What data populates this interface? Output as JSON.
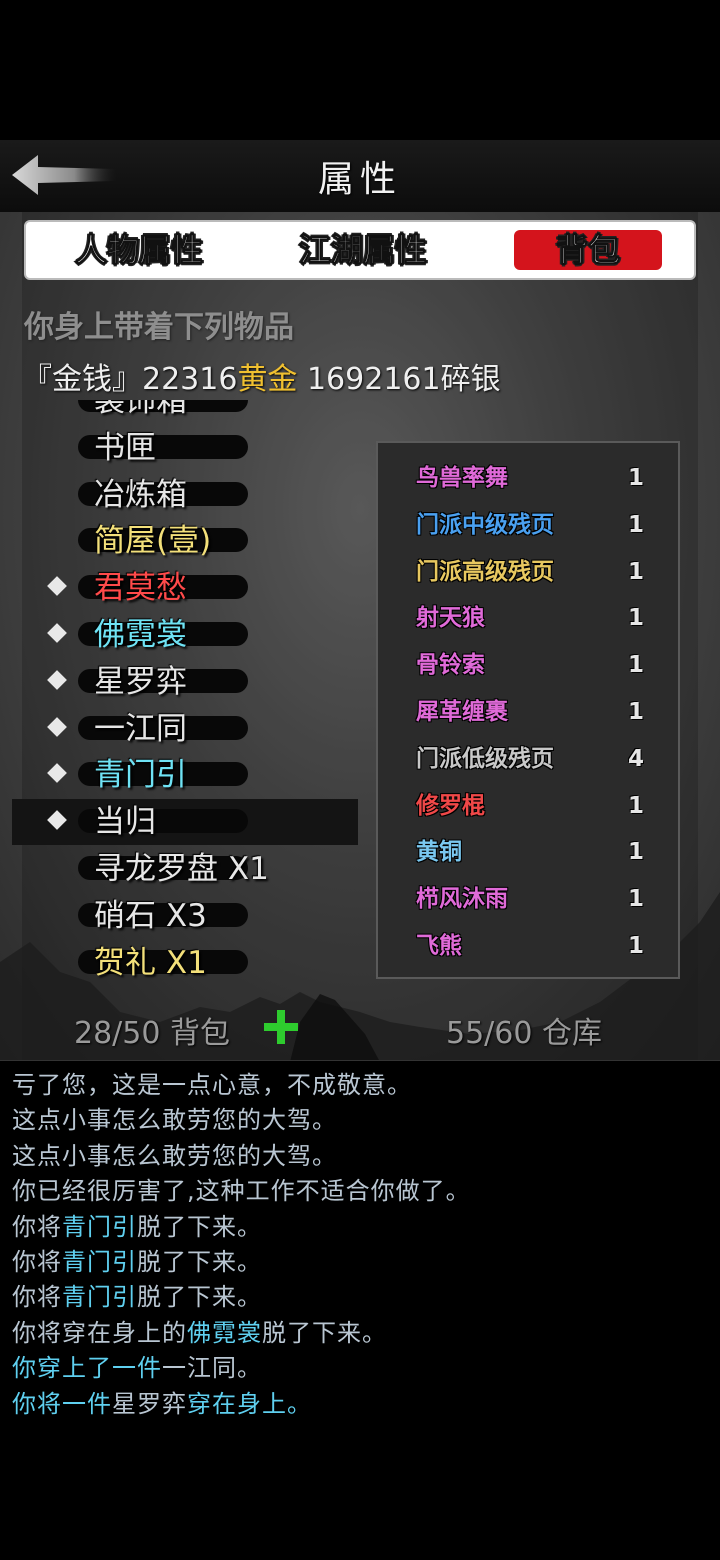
{
  "header": {
    "title": "属性"
  },
  "tabs": [
    {
      "label": "人物属性",
      "active": false
    },
    {
      "label": "江湖属性",
      "active": false
    },
    {
      "label": "背包",
      "active": true
    }
  ],
  "bag": {
    "heading": "你身上带着下列物品",
    "money": {
      "prefix": "『金钱』",
      "gold_amount": "22316",
      "gold_unit": "黄金",
      "silver_text": " 1692161碎银"
    },
    "items": [
      {
        "name": "装饰箱",
        "color": "#e6e6e6",
        "equipped": false,
        "partial": true
      },
      {
        "name": "书匣",
        "color": "#e6e6e6",
        "equipped": false
      },
      {
        "name": "冶炼箱",
        "color": "#e6e6e6",
        "equipped": false
      },
      {
        "name": "简屋(壹)",
        "color": "#f3e07a",
        "equipped": false
      },
      {
        "name": "君莫愁",
        "color": "#ff4a4a",
        "equipped": true
      },
      {
        "name": "佛霓裳",
        "color": "#6fe3f5",
        "equipped": true
      },
      {
        "name": "星罗弈",
        "color": "#e6e6e6",
        "equipped": true
      },
      {
        "name": "一江同",
        "color": "#e6e6e6",
        "equipped": true
      },
      {
        "name": "青门引",
        "color": "#6fe3f5",
        "equipped": true
      },
      {
        "name": "当归",
        "color": "#e6e6e6",
        "equipped": true,
        "selected": true
      },
      {
        "name": "寻龙罗盘 X1",
        "color": "#e6e6e6",
        "equipped": false
      },
      {
        "name": "硝石 X3",
        "color": "#e6e6e6",
        "equipped": false
      },
      {
        "name": "贺礼 X1",
        "color": "#f3e07a",
        "equipped": false
      }
    ],
    "sub_items": [
      {
        "name": "鸟兽率舞",
        "count": "1",
        "color": "#e06ad8"
      },
      {
        "name": "门派中级残页",
        "count": "1",
        "color": "#4aa0f0"
      },
      {
        "name": "门派高级残页",
        "count": "1",
        "color": "#e8c860"
      },
      {
        "name": "射天狼",
        "count": "1",
        "color": "#e06ad8"
      },
      {
        "name": "骨铃索",
        "count": "1",
        "color": "#e06ad8"
      },
      {
        "name": "犀革缠裹",
        "count": "1",
        "color": "#e06ad8"
      },
      {
        "name": "门派低级残页",
        "count": "4",
        "color": "#c8c8c8"
      },
      {
        "name": "修罗棍",
        "count": "1",
        "color": "#f04848"
      },
      {
        "name": "黄铜",
        "count": "1",
        "color": "#7ac8f0"
      },
      {
        "name": "栉风沐雨",
        "count": "1",
        "color": "#e06ad8"
      },
      {
        "name": "飞熊",
        "count": "1",
        "color": "#e06ad8"
      }
    ],
    "bag_count": "28/50 背包",
    "storage_count": "55/60 仓库"
  },
  "log": [
    {
      "segments": [
        {
          "t": "亏了您，这是一点心意，不成敬意。",
          "hl": false
        }
      ]
    },
    {
      "segments": [
        {
          "t": "这点小事怎么敢劳您的大驾。",
          "hl": false
        }
      ]
    },
    {
      "segments": [
        {
          "t": "这点小事怎么敢劳您的大驾。",
          "hl": false
        }
      ]
    },
    {
      "segments": [
        {
          "t": "你已经很厉害了,这种工作不适合你做了。",
          "hl": false
        }
      ]
    },
    {
      "segments": [
        {
          "t": "你将",
          "hl": false
        },
        {
          "t": "青门引",
          "hl": true
        },
        {
          "t": "脱了下来。",
          "hl": false
        }
      ]
    },
    {
      "segments": [
        {
          "t": "你将",
          "hl": false
        },
        {
          "t": "青门引",
          "hl": true
        },
        {
          "t": "脱了下来。",
          "hl": false
        }
      ]
    },
    {
      "segments": [
        {
          "t": "你将",
          "hl": false
        },
        {
          "t": "青门引",
          "hl": true
        },
        {
          "t": "脱了下来。",
          "hl": false
        }
      ]
    },
    {
      "segments": [
        {
          "t": "你将穿在身上的",
          "hl": false
        },
        {
          "t": "佛霓裳",
          "hl": true
        },
        {
          "t": "脱了下来。",
          "hl": false
        }
      ]
    },
    {
      "segments": [
        {
          "t": "你穿上了一件",
          "hl": true
        },
        {
          "t": "一江同。",
          "hl": false
        }
      ]
    },
    {
      "segments": [
        {
          "t": "你将一件",
          "hl": true
        },
        {
          "t": "星罗弈",
          "hl": false
        },
        {
          "t": "穿在身上。",
          "hl": true
        }
      ]
    }
  ]
}
